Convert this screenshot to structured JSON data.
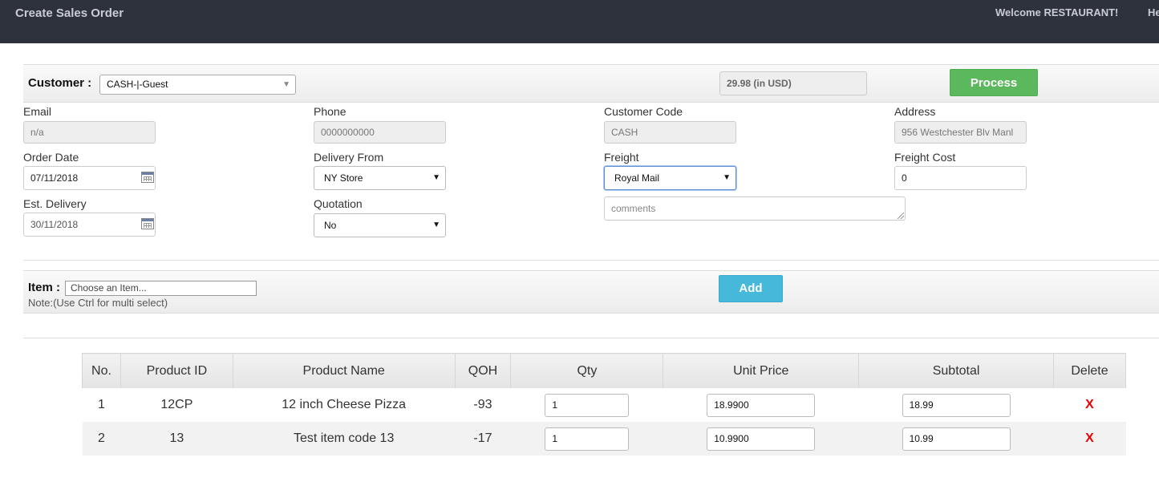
{
  "header": {
    "title": "Create Sales Order",
    "welcome": "Welcome RESTAURANT!",
    "help_truncated": "He"
  },
  "customer_bar": {
    "label": "Customer :",
    "selected": "CASH-|-Guest",
    "total": "29.98  (in USD)",
    "process_label": "Process"
  },
  "fields": {
    "email": {
      "label": "Email",
      "value": "n/a"
    },
    "phone": {
      "label": "Phone",
      "value": "0000000000"
    },
    "customer_code": {
      "label": "Customer Code",
      "value": "CASH"
    },
    "address": {
      "label": "Address",
      "value": "956 Westchester Blv Manl"
    },
    "order_date": {
      "label": "Order Date",
      "value": "07/11/2018"
    },
    "delivery_from": {
      "label": "Delivery From",
      "value": "NY Store"
    },
    "freight": {
      "label": "Freight",
      "value": "Royal Mail"
    },
    "freight_cost": {
      "label": "Freight Cost",
      "value": "0"
    },
    "est_delivery": {
      "label": "Est. Delivery",
      "value": "30/11/2018"
    },
    "quotation": {
      "label": "Quotation",
      "value": "No"
    },
    "comments": {
      "placeholder": "comments"
    }
  },
  "item_bar": {
    "label": "Item :",
    "placeholder": "Choose an Item...",
    "note": "Note:(Use Ctrl for multi select)",
    "add_label": "Add"
  },
  "table": {
    "headers": [
      "No.",
      "Product ID",
      "Product Name",
      "QOH",
      "Qty",
      "Unit Price",
      "Subtotal",
      "Delete"
    ],
    "rows": [
      {
        "no": "1",
        "product_id": "12CP",
        "product_name": "12 inch Cheese Pizza",
        "qoh": "-93",
        "qty": "1",
        "unit_price": "18.9900",
        "subtotal": "18.99",
        "delete": "X"
      },
      {
        "no": "2",
        "product_id": "13",
        "product_name": "Test item code 13",
        "qoh": "-17",
        "qty": "1",
        "unit_price": "10.9900",
        "subtotal": "10.99",
        "delete": "X"
      }
    ]
  },
  "colors": {
    "header_bg": "#2d323d",
    "process_green": "#5cb85c",
    "add_blue": "#46b8da",
    "delete_red": "#ee0000"
  }
}
